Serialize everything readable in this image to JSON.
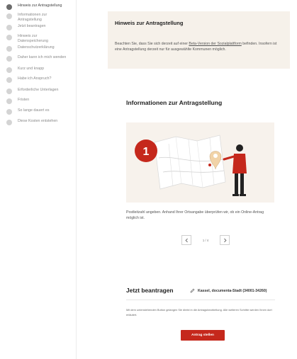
{
  "sidebar": {
    "items": [
      {
        "label": "Hinweis zur Antragstellung",
        "active": true
      },
      {
        "label": "Informationen zur Antragstellung",
        "active": false
      },
      {
        "label": "Jetzt beantragen",
        "active": false
      },
      {
        "label": "Hinweis zur Datenspeicherung",
        "active": false
      },
      {
        "label": "Datenschutzerklärung",
        "active": false
      },
      {
        "label": "Daher kann ich mich wenden",
        "active": false
      },
      {
        "label": "Kurz und knapp",
        "active": false
      },
      {
        "label": "Habe ich Anspruch?",
        "active": false
      },
      {
        "label": "Erforderliche Unterlagen",
        "active": false
      },
      {
        "label": "Fristen",
        "active": false
      },
      {
        "label": "So lange dauert es",
        "active": false
      },
      {
        "label": "Diese Kosten entstehen",
        "active": false
      }
    ]
  },
  "notice": {
    "title": "Hinweis zur Antragstellung",
    "text_before": "Beachten Sie, dass Sie sich derzeit auf einer ",
    "link": "Beta-Version der Sozialplattform",
    "text_after": " befinden. Insofern ist eine Antragstellung derzeit nur für ausgewählte Kommunen möglich."
  },
  "info": {
    "title": "Informationen zur Antragstellung",
    "step_number": "1",
    "caption": "Postleitzahl angeben. Anhand Ihrer Ortsangabe überprüfen wir, ob ein Online-Antrag möglich ist.",
    "pager": "1 / 4"
  },
  "apply": {
    "title": "Jetzt beantragen",
    "location": "Kassel, documenta-Stadt (34001-34260)",
    "description": "Mit dem untenstehenden Button gelangen Sie direkt in die Antragsbearbeitung. Alle weiteren Schritte werden Ihnen dort erläutert.",
    "button": "Antrag stellen"
  },
  "colors": {
    "accent": "#c5281c",
    "notice_bg": "#f6f1ea",
    "active_dot": "#6b6b6b"
  },
  "icons": {
    "pager_prev": "chevron-left-icon",
    "pager_next": "chevron-right-icon",
    "location": "pencil-icon"
  }
}
